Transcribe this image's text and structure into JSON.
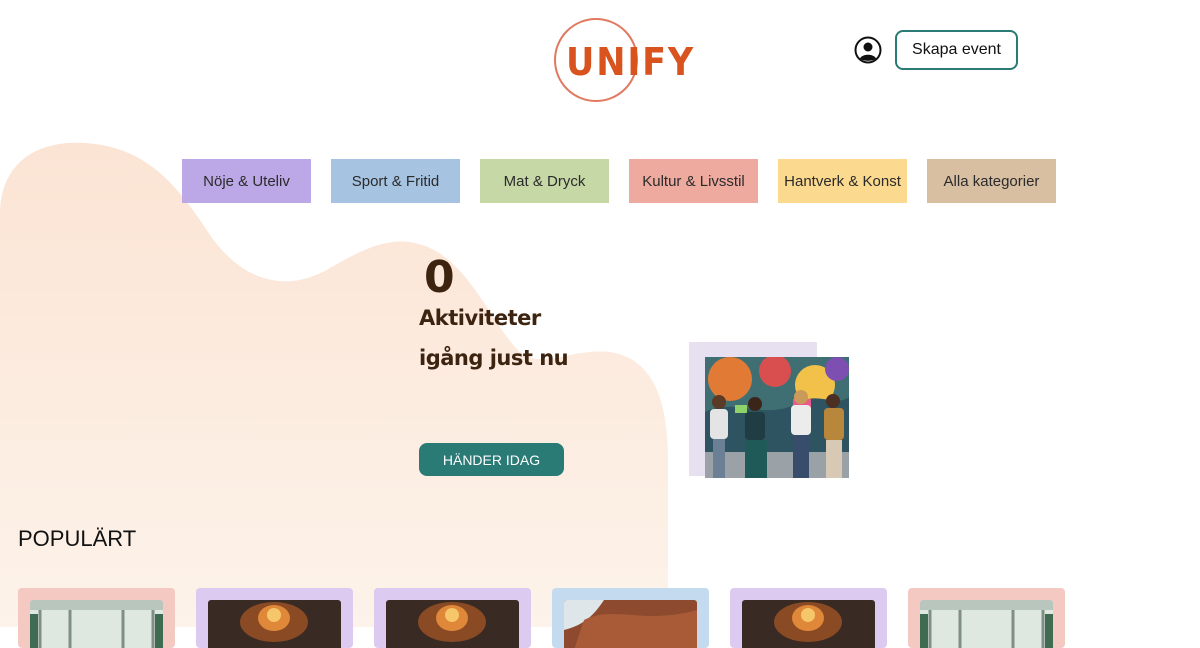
{
  "header": {
    "logo_text": "UNIFY",
    "create_event_label": "Skapa event",
    "user_icon": "user-circle-icon"
  },
  "categories": [
    {
      "label": "Nöje & Uteliv",
      "color": "#bca8e6"
    },
    {
      "label": "Sport & Fritid",
      "color": "#a6c4e2"
    },
    {
      "label": "Mat & Dryck",
      "color": "#c6d8a6"
    },
    {
      "label": "Kultur & Livsstil",
      "color": "#eeaa9f"
    },
    {
      "label": "Hantverk & Konst",
      "color": "#fbd98f"
    },
    {
      "label": "Alla kategorier",
      "color": "#d8bfa2"
    }
  ],
  "hero": {
    "count": "0",
    "line1": "Aktiviteter",
    "line2": "igång just nu",
    "button_label": "HÄNDER IDAG"
  },
  "popular": {
    "title": "POPULÄRT",
    "cards": [
      {
        "bg": "#f3c9c2",
        "image": "hall"
      },
      {
        "bg": "#dccaf0",
        "image": "fire"
      },
      {
        "bg": "#dccaf0",
        "image": "fire"
      },
      {
        "bg": "#c4dbef",
        "image": "rock"
      },
      {
        "bg": "#dccaf0",
        "image": "fire"
      },
      {
        "bg": "#f3c9c2",
        "image": "hall"
      }
    ]
  },
  "colors": {
    "accent": "#2a7a76",
    "logo": "#d9531e",
    "hero_text": "#3d2410",
    "blob": "#fcefe4"
  }
}
